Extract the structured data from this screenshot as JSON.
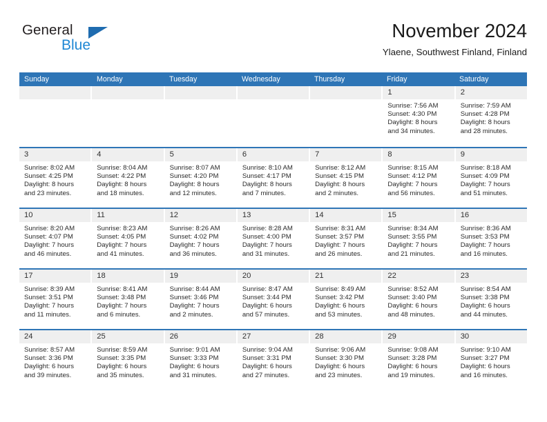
{
  "brand": {
    "name_part1": "General",
    "name_part2": "Blue",
    "triangle_icon": "triangle-icon",
    "accent_color": "#1f6cb0",
    "blue_color": "#1f87d4"
  },
  "header": {
    "month_title": "November 2024",
    "location": "Ylaene, Southwest Finland, Finland"
  },
  "calendar": {
    "header_color": "#2e75b6",
    "day_band_color": "#efefef",
    "weekdays": [
      "Sunday",
      "Monday",
      "Tuesday",
      "Wednesday",
      "Thursday",
      "Friday",
      "Saturday"
    ],
    "weeks": [
      [
        {
          "day": "",
          "empty": true
        },
        {
          "day": "",
          "empty": true
        },
        {
          "day": "",
          "empty": true
        },
        {
          "day": "",
          "empty": true
        },
        {
          "day": "",
          "empty": true
        },
        {
          "day": "1",
          "sunrise": "Sunrise: 7:56 AM",
          "sunset": "Sunset: 4:30 PM",
          "daylight1": "Daylight: 8 hours",
          "daylight2": "and 34 minutes."
        },
        {
          "day": "2",
          "sunrise": "Sunrise: 7:59 AM",
          "sunset": "Sunset: 4:28 PM",
          "daylight1": "Daylight: 8 hours",
          "daylight2": "and 28 minutes."
        }
      ],
      [
        {
          "day": "3",
          "sunrise": "Sunrise: 8:02 AM",
          "sunset": "Sunset: 4:25 PM",
          "daylight1": "Daylight: 8 hours",
          "daylight2": "and 23 minutes."
        },
        {
          "day": "4",
          "sunrise": "Sunrise: 8:04 AM",
          "sunset": "Sunset: 4:22 PM",
          "daylight1": "Daylight: 8 hours",
          "daylight2": "and 18 minutes."
        },
        {
          "day": "5",
          "sunrise": "Sunrise: 8:07 AM",
          "sunset": "Sunset: 4:20 PM",
          "daylight1": "Daylight: 8 hours",
          "daylight2": "and 12 minutes."
        },
        {
          "day": "6",
          "sunrise": "Sunrise: 8:10 AM",
          "sunset": "Sunset: 4:17 PM",
          "daylight1": "Daylight: 8 hours",
          "daylight2": "and 7 minutes."
        },
        {
          "day": "7",
          "sunrise": "Sunrise: 8:12 AM",
          "sunset": "Sunset: 4:15 PM",
          "daylight1": "Daylight: 8 hours",
          "daylight2": "and 2 minutes."
        },
        {
          "day": "8",
          "sunrise": "Sunrise: 8:15 AM",
          "sunset": "Sunset: 4:12 PM",
          "daylight1": "Daylight: 7 hours",
          "daylight2": "and 56 minutes."
        },
        {
          "day": "9",
          "sunrise": "Sunrise: 8:18 AM",
          "sunset": "Sunset: 4:09 PM",
          "daylight1": "Daylight: 7 hours",
          "daylight2": "and 51 minutes."
        }
      ],
      [
        {
          "day": "10",
          "sunrise": "Sunrise: 8:20 AM",
          "sunset": "Sunset: 4:07 PM",
          "daylight1": "Daylight: 7 hours",
          "daylight2": "and 46 minutes."
        },
        {
          "day": "11",
          "sunrise": "Sunrise: 8:23 AM",
          "sunset": "Sunset: 4:05 PM",
          "daylight1": "Daylight: 7 hours",
          "daylight2": "and 41 minutes."
        },
        {
          "day": "12",
          "sunrise": "Sunrise: 8:26 AM",
          "sunset": "Sunset: 4:02 PM",
          "daylight1": "Daylight: 7 hours",
          "daylight2": "and 36 minutes."
        },
        {
          "day": "13",
          "sunrise": "Sunrise: 8:28 AM",
          "sunset": "Sunset: 4:00 PM",
          "daylight1": "Daylight: 7 hours",
          "daylight2": "and 31 minutes."
        },
        {
          "day": "14",
          "sunrise": "Sunrise: 8:31 AM",
          "sunset": "Sunset: 3:57 PM",
          "daylight1": "Daylight: 7 hours",
          "daylight2": "and 26 minutes."
        },
        {
          "day": "15",
          "sunrise": "Sunrise: 8:34 AM",
          "sunset": "Sunset: 3:55 PM",
          "daylight1": "Daylight: 7 hours",
          "daylight2": "and 21 minutes."
        },
        {
          "day": "16",
          "sunrise": "Sunrise: 8:36 AM",
          "sunset": "Sunset: 3:53 PM",
          "daylight1": "Daylight: 7 hours",
          "daylight2": "and 16 minutes."
        }
      ],
      [
        {
          "day": "17",
          "sunrise": "Sunrise: 8:39 AM",
          "sunset": "Sunset: 3:51 PM",
          "daylight1": "Daylight: 7 hours",
          "daylight2": "and 11 minutes."
        },
        {
          "day": "18",
          "sunrise": "Sunrise: 8:41 AM",
          "sunset": "Sunset: 3:48 PM",
          "daylight1": "Daylight: 7 hours",
          "daylight2": "and 6 minutes."
        },
        {
          "day": "19",
          "sunrise": "Sunrise: 8:44 AM",
          "sunset": "Sunset: 3:46 PM",
          "daylight1": "Daylight: 7 hours",
          "daylight2": "and 2 minutes."
        },
        {
          "day": "20",
          "sunrise": "Sunrise: 8:47 AM",
          "sunset": "Sunset: 3:44 PM",
          "daylight1": "Daylight: 6 hours",
          "daylight2": "and 57 minutes."
        },
        {
          "day": "21",
          "sunrise": "Sunrise: 8:49 AM",
          "sunset": "Sunset: 3:42 PM",
          "daylight1": "Daylight: 6 hours",
          "daylight2": "and 53 minutes."
        },
        {
          "day": "22",
          "sunrise": "Sunrise: 8:52 AM",
          "sunset": "Sunset: 3:40 PM",
          "daylight1": "Daylight: 6 hours",
          "daylight2": "and 48 minutes."
        },
        {
          "day": "23",
          "sunrise": "Sunrise: 8:54 AM",
          "sunset": "Sunset: 3:38 PM",
          "daylight1": "Daylight: 6 hours",
          "daylight2": "and 44 minutes."
        }
      ],
      [
        {
          "day": "24",
          "sunrise": "Sunrise: 8:57 AM",
          "sunset": "Sunset: 3:36 PM",
          "daylight1": "Daylight: 6 hours",
          "daylight2": "and 39 minutes."
        },
        {
          "day": "25",
          "sunrise": "Sunrise: 8:59 AM",
          "sunset": "Sunset: 3:35 PM",
          "daylight1": "Daylight: 6 hours",
          "daylight2": "and 35 minutes."
        },
        {
          "day": "26",
          "sunrise": "Sunrise: 9:01 AM",
          "sunset": "Sunset: 3:33 PM",
          "daylight1": "Daylight: 6 hours",
          "daylight2": "and 31 minutes."
        },
        {
          "day": "27",
          "sunrise": "Sunrise: 9:04 AM",
          "sunset": "Sunset: 3:31 PM",
          "daylight1": "Daylight: 6 hours",
          "daylight2": "and 27 minutes."
        },
        {
          "day": "28",
          "sunrise": "Sunrise: 9:06 AM",
          "sunset": "Sunset: 3:30 PM",
          "daylight1": "Daylight: 6 hours",
          "daylight2": "and 23 minutes."
        },
        {
          "day": "29",
          "sunrise": "Sunrise: 9:08 AM",
          "sunset": "Sunset: 3:28 PM",
          "daylight1": "Daylight: 6 hours",
          "daylight2": "and 19 minutes."
        },
        {
          "day": "30",
          "sunrise": "Sunrise: 9:10 AM",
          "sunset": "Sunset: 3:27 PM",
          "daylight1": "Daylight: 6 hours",
          "daylight2": "and 16 minutes."
        }
      ]
    ]
  }
}
